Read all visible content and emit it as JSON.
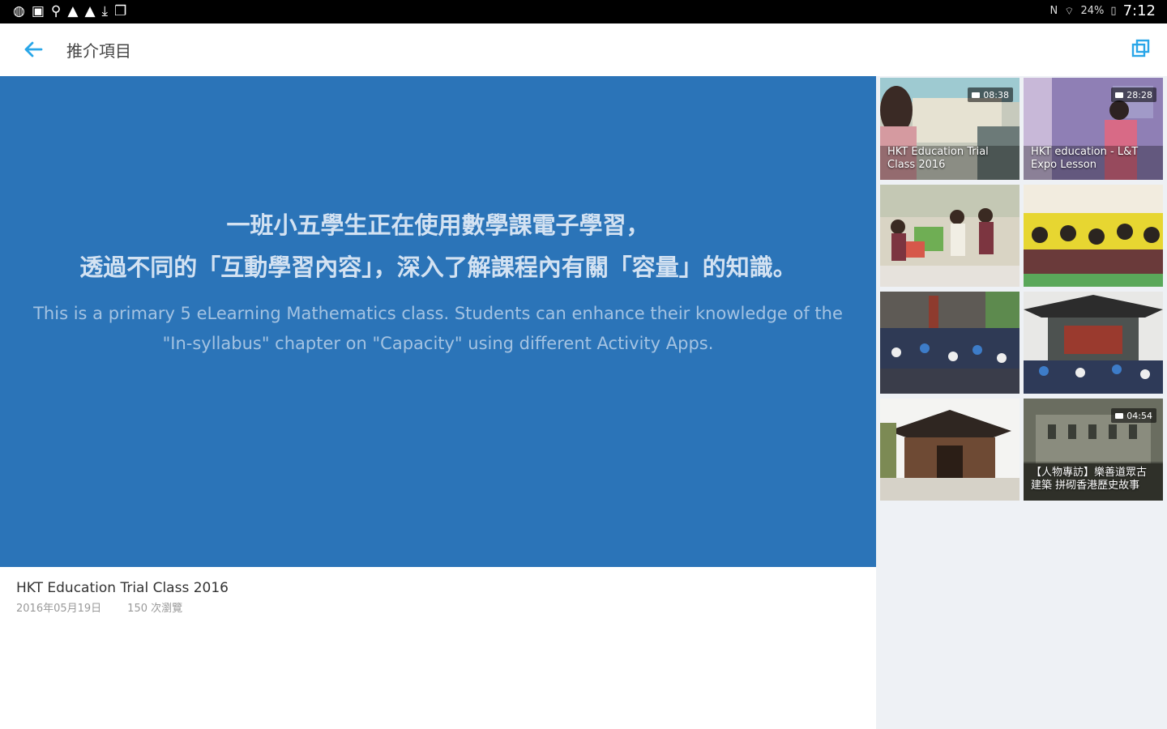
{
  "status": {
    "left_icons": [
      "vpn-icon",
      "gallery-icon",
      "location-pin-icon",
      "warning-icon",
      "warning-icon",
      "download-icon",
      "photos-icon"
    ],
    "nfc": "N",
    "battery": "24%",
    "time": "7:12"
  },
  "appbar": {
    "title": "推介項目"
  },
  "hero": {
    "zh_line1": "一班小五學生正在使用數學課電子學習，",
    "zh_line2": "透過不同的「互動學習內容」，深入了解課程內有關「容量」的知識。",
    "en_line1": "This is a primary 5 eLearning Mathematics class. Students can enhance their knowledge of the",
    "en_line2": "\"In-syllabus\" chapter on \"Capacity\" using different Activity Apps."
  },
  "video": {
    "title": "HKT Education Trial Class 2016",
    "date": "2016年05月19日",
    "views": "150 次瀏覽"
  },
  "thumbnails": [
    {
      "caption": "HKT Education Trial Class 2016",
      "duration": "08:38"
    },
    {
      "caption": "HKT education - L&T Expo Lesson",
      "duration": "28:28"
    },
    {
      "caption": "",
      "duration": ""
    },
    {
      "caption": "",
      "duration": ""
    },
    {
      "caption": "",
      "duration": ""
    },
    {
      "caption": "",
      "duration": ""
    },
    {
      "caption": "",
      "duration": ""
    },
    {
      "caption": "【人物專訪】樂善道眾古建築 拼砌香港歷史故事",
      "duration": "04:54"
    }
  ],
  "colors": {
    "accent": "#29a6e8",
    "hero_bg": "#2b74b8"
  }
}
